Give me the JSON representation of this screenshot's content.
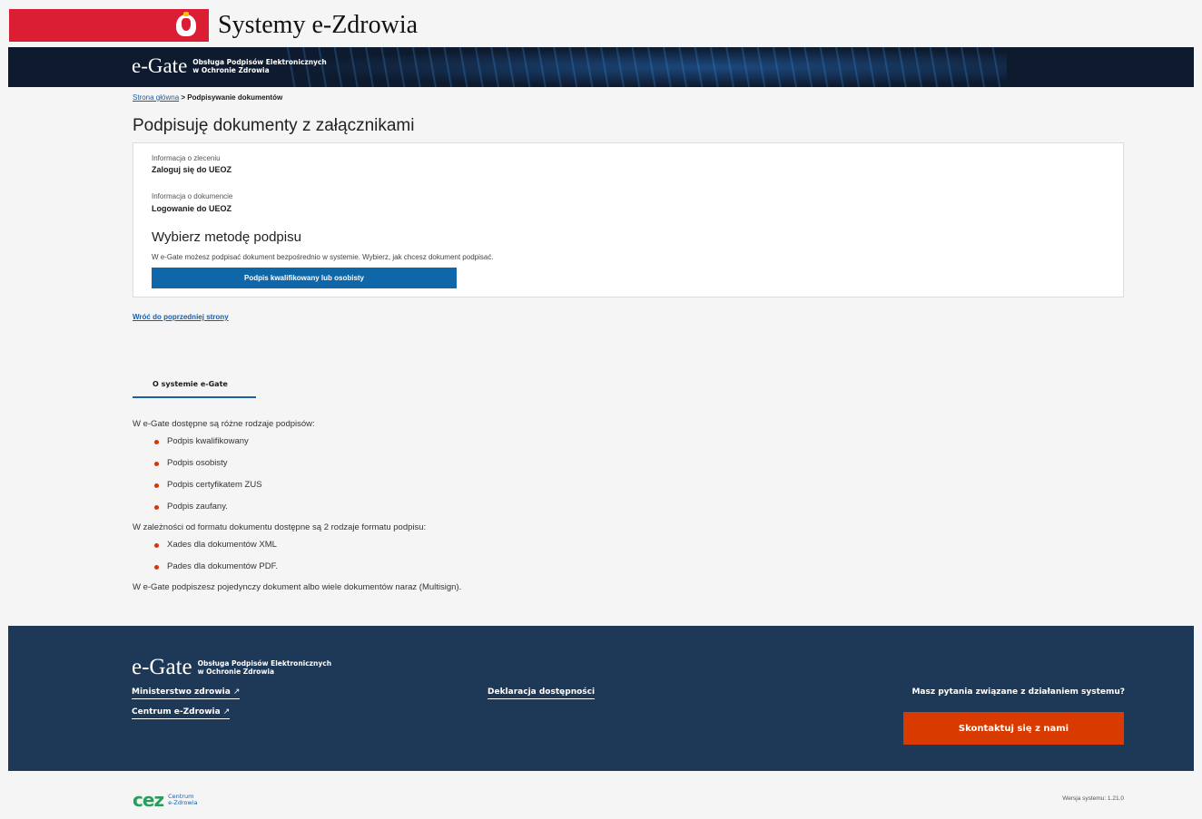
{
  "header": {
    "site_title": "Systemy e-Zdrowia",
    "logo_big": "e-Gate",
    "logo_line1": "Obsługa Podpisów Elektronicznych",
    "logo_line2": "w Ochronie Zdrowia"
  },
  "breadcrumb": {
    "home": "Strona główna",
    "separator": " > ",
    "current": "Podpisywanie dokumentów"
  },
  "page_title": "Podpisuję dokumenty z załącznikami",
  "card": {
    "order_label": "Informacja o zleceniu",
    "order_value": "Zaloguj się do UEOZ",
    "doc_label": "Informacja o dokumencie",
    "doc_value": "Logowanie do UEOZ",
    "method_heading": "Wybierz metodę podpisu",
    "method_info": "W e-Gate możesz podpisać dokument bezpośrednio w systemie. Wybierz, jak chcesz dokument podpisać.",
    "sign_button": "Podpis kwalifikowany lub osobisty"
  },
  "back_link": "Wróć do poprzedniej strony",
  "about": {
    "tab": "O systemie e-Gate",
    "intro": "W e-Gate dostępne są różne rodzaje podpisów:",
    "types": [
      "Podpis kwalifikowany",
      "Podpis osobisty",
      "Podpis certyfikatem ZUS",
      "Podpis zaufany."
    ],
    "format_intro": "W zależności od formatu dokumentu dostępne są 2 rodzaje formatu podpisu:",
    "formats": [
      "Xades dla dokumentów XML",
      "Pades dla dokumentów PDF."
    ],
    "outro": "W e-Gate podpiszesz pojedynczy dokument albo wiele dokumentów naraz (Multisign)."
  },
  "footer": {
    "link_ministry": "Ministerstwo zdrowia",
    "link_cez": "Centrum e-Zdrowia",
    "link_accessibility": "Deklaracja dostępności",
    "external_icon": "↗",
    "question": "Masz pytania związane z działaniem systemu?",
    "contact_button": "Skontaktuj się z nami"
  },
  "bottom": {
    "cez_mark_c": "c",
    "cez_mark_e": "e",
    "cez_mark_z": "z",
    "cez_line1": "Centrum",
    "cez_line2": "e-Zdrowia",
    "version": "Wersja systemu: 1.21.0"
  },
  "colors": {
    "accent_blue": "#0f66a8",
    "navy": "#1e3858",
    "contact_orange": "#d83a00",
    "flag_red": "#dc1e35"
  }
}
